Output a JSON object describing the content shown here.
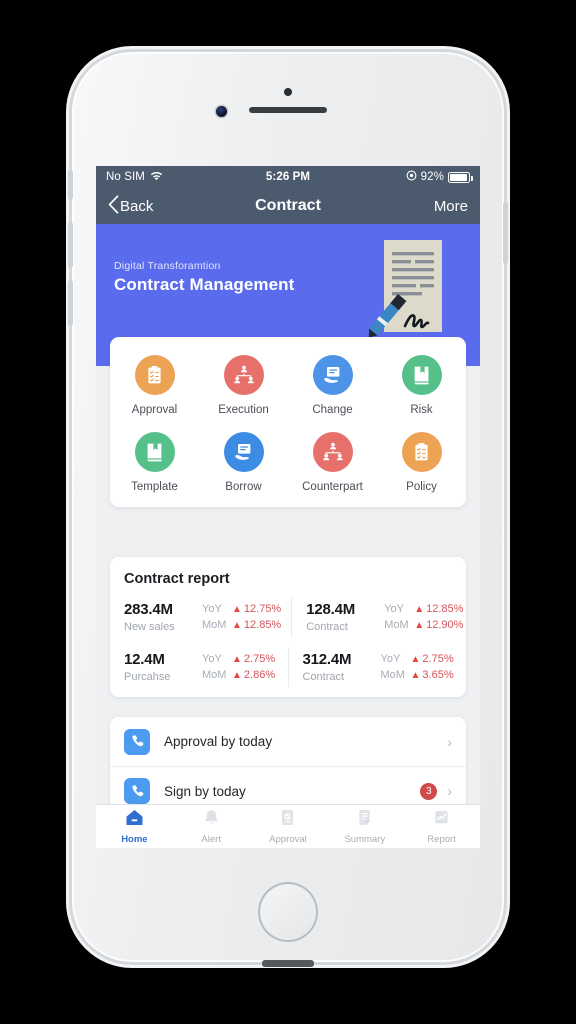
{
  "status_bar": {
    "carrier": "No SIM",
    "wifi_icon": "wifi-icon",
    "time": "5:26 PM",
    "location_icon": "location-services-icon",
    "battery_percent": "92%",
    "battery_level": 92
  },
  "nav_bar": {
    "back_label": "Back",
    "back_icon": "chevron-left-icon",
    "title": "Contract",
    "more_label": "More"
  },
  "hero": {
    "subtitle": "Digital Transforamtion",
    "title": "Contract Management",
    "bg_color": "#5b6bee",
    "art_icon": "signed-contract-illustration"
  },
  "grid": {
    "rows": [
      [
        {
          "label": "Approval",
          "icon": "checklist-clipboard-icon",
          "color": "#eda354"
        },
        {
          "label": "Execution",
          "icon": "org-chart-people-icon",
          "color": "#e8706b"
        },
        {
          "label": "Change",
          "icon": "document-on-hand-icon",
          "color": "#4d94e8"
        },
        {
          "label": "Risk",
          "icon": "book-bookmark-icon",
          "color": "#56c08a"
        }
      ],
      [
        {
          "label": "Template",
          "icon": "book-bookmark-icon",
          "color": "#56c08a"
        },
        {
          "label": "Borrow",
          "icon": "document-on-hand-icon",
          "color": "#3d8ce4"
        },
        {
          "label": "Counterpart",
          "icon": "org-chart-people-icon",
          "color": "#e8706b"
        },
        {
          "label": "Policy",
          "icon": "checklist-clipboard-icon",
          "color": "#eda354"
        }
      ]
    ]
  },
  "report": {
    "title": "Contract report",
    "yoy_label": "YoY",
    "mom_label": "MoM",
    "up_arrow": "arrow-up-icon",
    "accent_color": "#d6545a",
    "rows": [
      [
        {
          "value": "283.4M",
          "caption": "New sales",
          "yoy": "12.75%",
          "mom": "12.85%"
        },
        {
          "value": "128.4M",
          "caption": "Contract",
          "yoy": "12.85%",
          "mom": "12.90%"
        }
      ],
      [
        {
          "value": "12.4M",
          "caption": "Purcahse",
          "yoy": "2.75%",
          "mom": "2.86%"
        },
        {
          "value": "312.4M",
          "caption": "Contract",
          "yoy": "2.75%",
          "mom": "3.65%"
        }
      ]
    ]
  },
  "list": {
    "items": [
      {
        "label": "Approval by today",
        "icon": "phone-call-icon",
        "badge": "",
        "chevron": "chevron-right-icon"
      },
      {
        "label": "Sign by today",
        "icon": "phone-call-icon",
        "badge": "3",
        "chevron": "chevron-right-icon"
      }
    ]
  },
  "tab_bar": {
    "active_color": "#2f6fd0",
    "items": [
      {
        "label": "Home",
        "icon": "home-icon",
        "active": true
      },
      {
        "label": "Alert",
        "icon": "bell-icon",
        "active": false
      },
      {
        "label": "Approval",
        "icon": "approval-icon",
        "active": false
      },
      {
        "label": "Summary",
        "icon": "summary-icon",
        "active": false
      },
      {
        "label": "Report",
        "icon": "chart-icon",
        "active": false
      }
    ]
  }
}
